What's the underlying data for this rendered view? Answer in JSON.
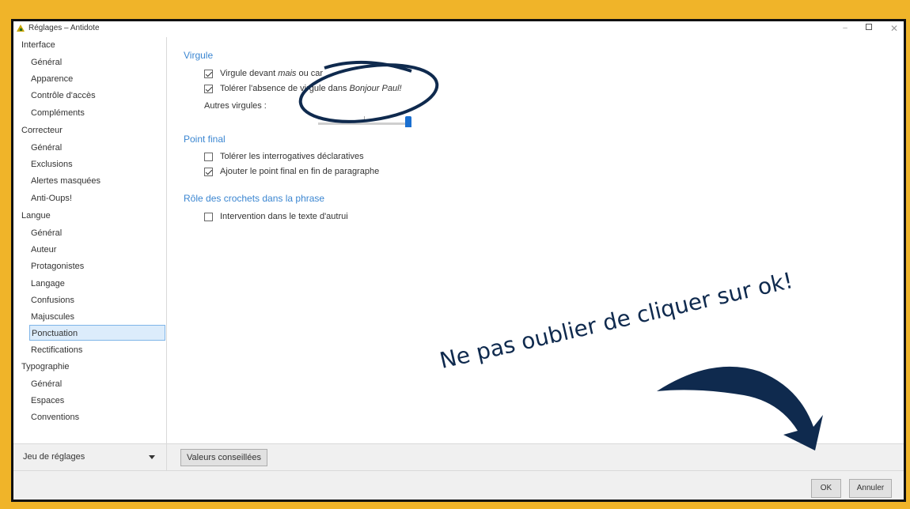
{
  "window": {
    "title": "Réglages – Antidote",
    "controls": {
      "minimize": "–",
      "close": "✕"
    }
  },
  "sidebar": {
    "sections": [
      {
        "label": "Interface",
        "items": [
          "Général",
          "Apparence",
          "Contrôle d'accès",
          "Compléments"
        ]
      },
      {
        "label": "Correcteur",
        "items": [
          "Général",
          "Exclusions",
          "Alertes masquées",
          "Anti-Oups!"
        ]
      },
      {
        "label": "Langue",
        "items": [
          "Général",
          "Auteur",
          "Protagonistes",
          "Langage",
          "Confusions",
          "Majuscules",
          "Ponctuation",
          "Rectifications"
        ]
      },
      {
        "label": "Typographie",
        "items": [
          "Général",
          "Espaces",
          "Conventions"
        ]
      }
    ],
    "selected": "Ponctuation"
  },
  "content": {
    "virgule": {
      "title": "Virgule",
      "opt1_prefix": "Virgule devant ",
      "opt1_em": "mais",
      "opt1_suffix": " ou car",
      "opt1_checked": true,
      "opt2_prefix": "Tolérer l'absence de virgule dans ",
      "opt2_em": "Bonjour Paul!",
      "opt2_checked": true,
      "slider_label": "Autres virgules :",
      "slider_value": 1.0
    },
    "point_final": {
      "title": "Point final",
      "opt1": "Tolérer les interrogatives déclaratives",
      "opt1_checked": false,
      "opt2": "Ajouter le point final en fin de paragraphe",
      "opt2_checked": true
    },
    "crochets": {
      "title": "Rôle des crochets dans la phrase",
      "opt1": "Intervention dans le texte d'autrui",
      "opt1_checked": false
    }
  },
  "bottom": {
    "preset_label": "Jeu de réglages",
    "recommended_button": "Valeurs conseillées"
  },
  "footer": {
    "ok": "OK",
    "cancel": "Annuler"
  },
  "annotation": {
    "note": "Ne pas oublier de cliquer sur ok!",
    "color": "#0f2a4e"
  },
  "colors": {
    "border": "#f0b429",
    "accent": "#3b86d1",
    "selection": "#dcecfb"
  }
}
